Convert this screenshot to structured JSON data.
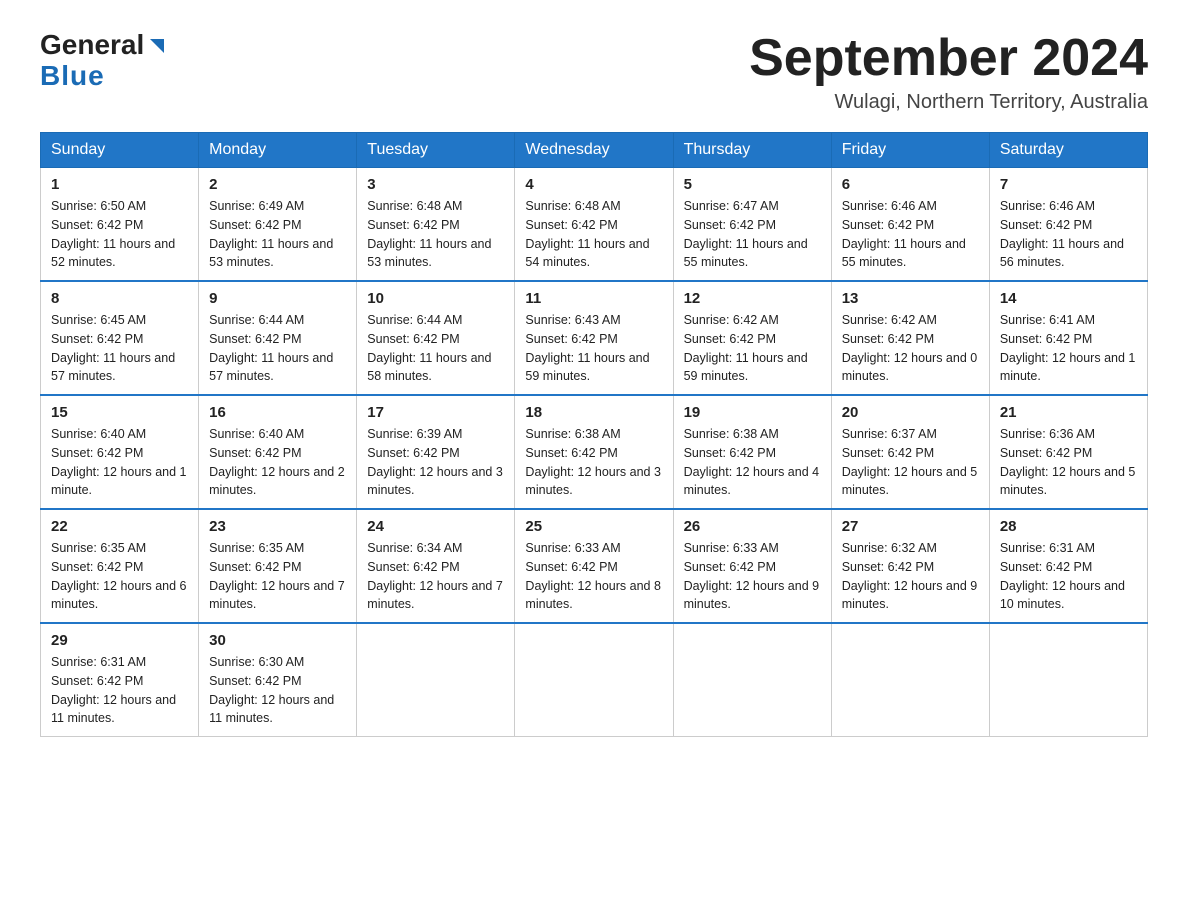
{
  "logo": {
    "general": "General",
    "blue": "Blue"
  },
  "header": {
    "month": "September 2024",
    "location": "Wulagi, Northern Territory, Australia"
  },
  "weekdays": [
    "Sunday",
    "Monday",
    "Tuesday",
    "Wednesday",
    "Thursday",
    "Friday",
    "Saturday"
  ],
  "weeks": [
    [
      {
        "day": "1",
        "sunrise": "6:50 AM",
        "sunset": "6:42 PM",
        "daylight": "11 hours and 52 minutes."
      },
      {
        "day": "2",
        "sunrise": "6:49 AM",
        "sunset": "6:42 PM",
        "daylight": "11 hours and 53 minutes."
      },
      {
        "day": "3",
        "sunrise": "6:48 AM",
        "sunset": "6:42 PM",
        "daylight": "11 hours and 53 minutes."
      },
      {
        "day": "4",
        "sunrise": "6:48 AM",
        "sunset": "6:42 PM",
        "daylight": "11 hours and 54 minutes."
      },
      {
        "day": "5",
        "sunrise": "6:47 AM",
        "sunset": "6:42 PM",
        "daylight": "11 hours and 55 minutes."
      },
      {
        "day": "6",
        "sunrise": "6:46 AM",
        "sunset": "6:42 PM",
        "daylight": "11 hours and 55 minutes."
      },
      {
        "day": "7",
        "sunrise": "6:46 AM",
        "sunset": "6:42 PM",
        "daylight": "11 hours and 56 minutes."
      }
    ],
    [
      {
        "day": "8",
        "sunrise": "6:45 AM",
        "sunset": "6:42 PM",
        "daylight": "11 hours and 57 minutes."
      },
      {
        "day": "9",
        "sunrise": "6:44 AM",
        "sunset": "6:42 PM",
        "daylight": "11 hours and 57 minutes."
      },
      {
        "day": "10",
        "sunrise": "6:44 AM",
        "sunset": "6:42 PM",
        "daylight": "11 hours and 58 minutes."
      },
      {
        "day": "11",
        "sunrise": "6:43 AM",
        "sunset": "6:42 PM",
        "daylight": "11 hours and 59 minutes."
      },
      {
        "day": "12",
        "sunrise": "6:42 AM",
        "sunset": "6:42 PM",
        "daylight": "11 hours and 59 minutes."
      },
      {
        "day": "13",
        "sunrise": "6:42 AM",
        "sunset": "6:42 PM",
        "daylight": "12 hours and 0 minutes."
      },
      {
        "day": "14",
        "sunrise": "6:41 AM",
        "sunset": "6:42 PM",
        "daylight": "12 hours and 1 minute."
      }
    ],
    [
      {
        "day": "15",
        "sunrise": "6:40 AM",
        "sunset": "6:42 PM",
        "daylight": "12 hours and 1 minute."
      },
      {
        "day": "16",
        "sunrise": "6:40 AM",
        "sunset": "6:42 PM",
        "daylight": "12 hours and 2 minutes."
      },
      {
        "day": "17",
        "sunrise": "6:39 AM",
        "sunset": "6:42 PM",
        "daylight": "12 hours and 3 minutes."
      },
      {
        "day": "18",
        "sunrise": "6:38 AM",
        "sunset": "6:42 PM",
        "daylight": "12 hours and 3 minutes."
      },
      {
        "day": "19",
        "sunrise": "6:38 AM",
        "sunset": "6:42 PM",
        "daylight": "12 hours and 4 minutes."
      },
      {
        "day": "20",
        "sunrise": "6:37 AM",
        "sunset": "6:42 PM",
        "daylight": "12 hours and 5 minutes."
      },
      {
        "day": "21",
        "sunrise": "6:36 AM",
        "sunset": "6:42 PM",
        "daylight": "12 hours and 5 minutes."
      }
    ],
    [
      {
        "day": "22",
        "sunrise": "6:35 AM",
        "sunset": "6:42 PM",
        "daylight": "12 hours and 6 minutes."
      },
      {
        "day": "23",
        "sunrise": "6:35 AM",
        "sunset": "6:42 PM",
        "daylight": "12 hours and 7 minutes."
      },
      {
        "day": "24",
        "sunrise": "6:34 AM",
        "sunset": "6:42 PM",
        "daylight": "12 hours and 7 minutes."
      },
      {
        "day": "25",
        "sunrise": "6:33 AM",
        "sunset": "6:42 PM",
        "daylight": "12 hours and 8 minutes."
      },
      {
        "day": "26",
        "sunrise": "6:33 AM",
        "sunset": "6:42 PM",
        "daylight": "12 hours and 9 minutes."
      },
      {
        "day": "27",
        "sunrise": "6:32 AM",
        "sunset": "6:42 PM",
        "daylight": "12 hours and 9 minutes."
      },
      {
        "day": "28",
        "sunrise": "6:31 AM",
        "sunset": "6:42 PM",
        "daylight": "12 hours and 10 minutes."
      }
    ],
    [
      {
        "day": "29",
        "sunrise": "6:31 AM",
        "sunset": "6:42 PM",
        "daylight": "12 hours and 11 minutes."
      },
      {
        "day": "30",
        "sunrise": "6:30 AM",
        "sunset": "6:42 PM",
        "daylight": "12 hours and 11 minutes."
      },
      null,
      null,
      null,
      null,
      null
    ]
  ],
  "labels": {
    "sunrise": "Sunrise:",
    "sunset": "Sunset:",
    "daylight": "Daylight:"
  }
}
